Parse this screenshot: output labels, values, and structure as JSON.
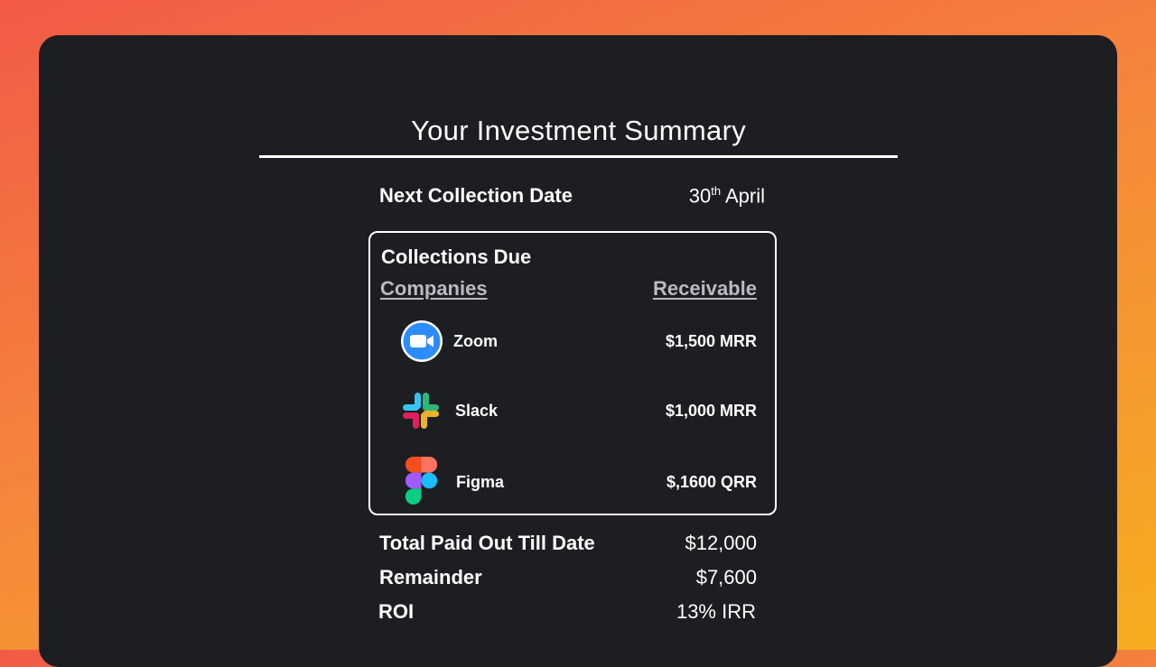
{
  "summary": {
    "title": "Your Investment Summary",
    "next_collection_label": "Next Collection Date",
    "next_collection_day": "30",
    "next_collection_suffix": "th",
    "next_collection_month": " April"
  },
  "collections": {
    "title": "Collections Due",
    "col_companies": "Companies",
    "col_receivable": "Receivable",
    "items": [
      {
        "name": "Zoom",
        "amount": "$1,500 MRR",
        "icon": "zoom-logo-icon"
      },
      {
        "name": "Slack",
        "amount": "$1,000 MRR",
        "icon": "slack-logo-icon"
      },
      {
        "name": "Figma",
        "amount": "$,1600 QRR",
        "icon": "figma-logo-icon"
      }
    ]
  },
  "totals": {
    "paid_label": "Total Paid Out Till Date",
    "paid_value": "$12,000",
    "remainder_label": "Remainder",
    "remainder_value": "$7,600",
    "roi_label": "ROI",
    "roi_value": "13% IRR"
  },
  "colors": {
    "panel": "#1d1e22",
    "zoom_blue": "#2d8cff",
    "header_muted": "#b9bac2"
  }
}
